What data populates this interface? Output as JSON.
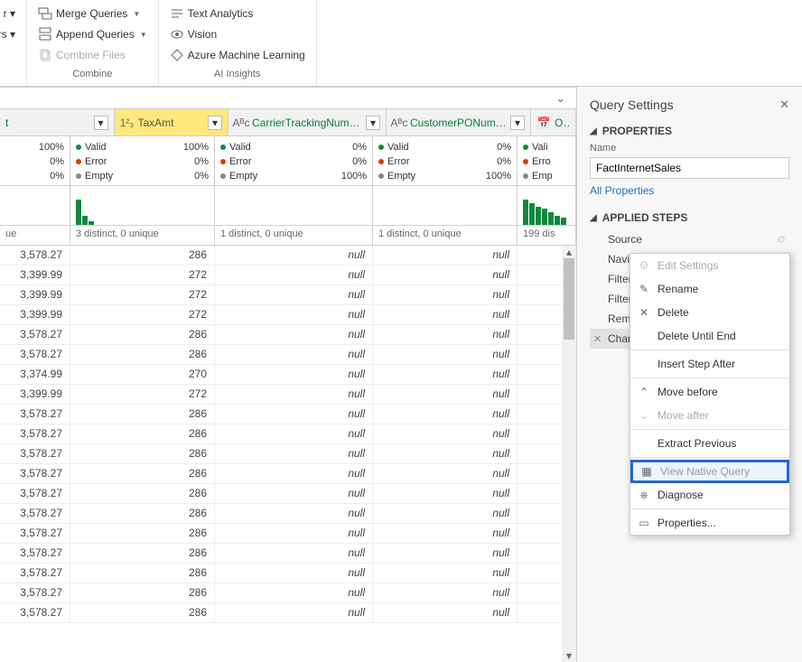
{
  "ribbon": {
    "left": {
      "r": "r ▾",
      "ders": "ders ▾"
    },
    "combine": {
      "merge": "Merge Queries",
      "append": "Append Queries",
      "combine_files": "Combine Files",
      "label": "Combine"
    },
    "ai": {
      "text": "Text Analytics",
      "vision": "Vision",
      "azure": "Azure Machine Learning",
      "label": "AI Insights"
    }
  },
  "columns": [
    {
      "name_trunc": "t",
      "filter": true
    },
    {
      "name": "TaxAmt",
      "type": "num",
      "selected": true
    },
    {
      "name": "CarrierTrackingNumber",
      "type": "text"
    },
    {
      "name": "CustomerPONumber",
      "type": "text"
    },
    {
      "name_trunc": "Ord",
      "type": "date"
    }
  ],
  "quality": {
    "labels": {
      "valid": "Valid",
      "error": "Error",
      "empty": "Empty"
    },
    "col0": {
      "valid": "100%",
      "error": "0%",
      "empty": "0%"
    },
    "col1": {
      "valid": "100%",
      "error": "0%",
      "empty": "0%"
    },
    "col2": {
      "valid": "0%",
      "error": "0%",
      "empty": "100%"
    },
    "col3": {
      "valid": "0%",
      "error": "0%",
      "empty": "100%"
    },
    "col4": {
      "valid": "Vali",
      "error": "Erro",
      "empty": "Emp"
    }
  },
  "distinct": {
    "col0": "ue",
    "col1": "3 distinct, 0 unique",
    "col2": "1 distinct, 0 unique",
    "col3": "1 distinct, 0 unique",
    "col4": "199 dis"
  },
  "rows": [
    {
      "c0": "3,578.27",
      "c1": "286",
      "c2": "null",
      "c3": "null"
    },
    {
      "c0": "3,399.99",
      "c1": "272",
      "c2": "null",
      "c3": "null"
    },
    {
      "c0": "3,399.99",
      "c1": "272",
      "c2": "null",
      "c3": "null"
    },
    {
      "c0": "3,399.99",
      "c1": "272",
      "c2": "null",
      "c3": "null"
    },
    {
      "c0": "3,578.27",
      "c1": "286",
      "c2": "null",
      "c3": "null"
    },
    {
      "c0": "3,578.27",
      "c1": "286",
      "c2": "null",
      "c3": "null"
    },
    {
      "c0": "3,374.99",
      "c1": "270",
      "c2": "null",
      "c3": "null"
    },
    {
      "c0": "3,399.99",
      "c1": "272",
      "c2": "null",
      "c3": "null"
    },
    {
      "c0": "3,578.27",
      "c1": "286",
      "c2": "null",
      "c3": "null"
    },
    {
      "c0": "3,578.27",
      "c1": "286",
      "c2": "null",
      "c3": "null"
    },
    {
      "c0": "3,578.27",
      "c1": "286",
      "c2": "null",
      "c3": "null"
    },
    {
      "c0": "3,578.27",
      "c1": "286",
      "c2": "null",
      "c3": "null"
    },
    {
      "c0": "3,578.27",
      "c1": "286",
      "c2": "null",
      "c3": "null"
    },
    {
      "c0": "3,578.27",
      "c1": "286",
      "c2": "null",
      "c3": "null"
    },
    {
      "c0": "3,578.27",
      "c1": "286",
      "c2": "null",
      "c3": "null"
    },
    {
      "c0": "3,578.27",
      "c1": "286",
      "c2": "null",
      "c3": "null"
    },
    {
      "c0": "3,578.27",
      "c1": "286",
      "c2": "null",
      "c3": "null"
    },
    {
      "c0": "3,578.27",
      "c1": "286",
      "c2": "null",
      "c3": "null"
    },
    {
      "c0": "3,578.27",
      "c1": "286",
      "c2": "null",
      "c3": "null"
    }
  ],
  "right_panel": {
    "title": "Query Settings",
    "properties": "PROPERTIES",
    "name_label": "Name",
    "name_value": "FactInternetSales",
    "all_props": "All Properties",
    "applied": "APPLIED STEPS",
    "steps": [
      {
        "label": "Source",
        "gear": true
      },
      {
        "label": "Navigation",
        "gear": true
      },
      {
        "label": "Filtered Rows",
        "gear": true
      },
      {
        "label": "Filtered Rows1",
        "gear": true
      },
      {
        "label": "Removed Columns"
      },
      {
        "label": "Chang",
        "sel": true,
        "x": true
      }
    ]
  },
  "ctx": {
    "edit": "Edit Settings",
    "rename": "Rename",
    "delete": "Delete",
    "delete_until": "Delete Until End",
    "insert_after": "Insert Step After",
    "move_before": "Move before",
    "move_after": "Move after",
    "extract": "Extract Previous",
    "view_native": "View Native Query",
    "diagnose": "Diagnose",
    "properties": "Properties..."
  }
}
